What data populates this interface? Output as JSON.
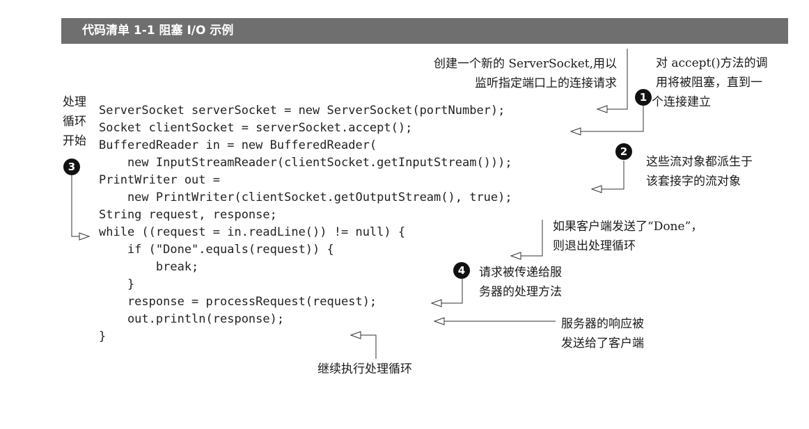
{
  "title": "代码清单 1-1  阻塞 I/O 示例",
  "code_lines": [
    "ServerSocket serverSocket = new ServerSocket(portNumber);",
    "Socket clientSocket = serverSocket.accept();",
    "BufferedReader in = new BufferedReader(",
    "    new InputStreamReader(clientSocket.getInputStream()));",
    "PrintWriter out =",
    "    new PrintWriter(clientSocket.getOutputStream(), true);",
    "String request, response;",
    "while ((request = in.readLine()) != null) {",
    "    if (\"Done\".equals(request)) {",
    "        break;",
    "    }",
    "    response = processRequest(request);",
    "    out.println(response);",
    "}"
  ],
  "annotations": {
    "create_socket": [
      "创建一个新的 ServerSocket,用以",
      "监听指定端口上的连接请求"
    ],
    "accept_blocks": [
      "对  accept()方法的调",
      "用将被阻塞，直到一",
      "个连接建立"
    ],
    "streams": [
      "这些流对象都派生于",
      "该套接字的流对象"
    ],
    "loop_start": [
      "处理",
      "循环",
      "开始"
    ],
    "done_exit": [
      "如果客户端发送了“Done”，",
      "则退出处理循环"
    ],
    "process_request": [
      "请求被传递给服",
      "务器的处理方法"
    ],
    "response_sent": [
      "服务器的响应被",
      "发送给了客户端"
    ],
    "continue_loop": [
      "继续执行处理循环"
    ]
  },
  "badges": {
    "b1": "1",
    "b2": "2",
    "b3": "3",
    "b4": "4"
  }
}
